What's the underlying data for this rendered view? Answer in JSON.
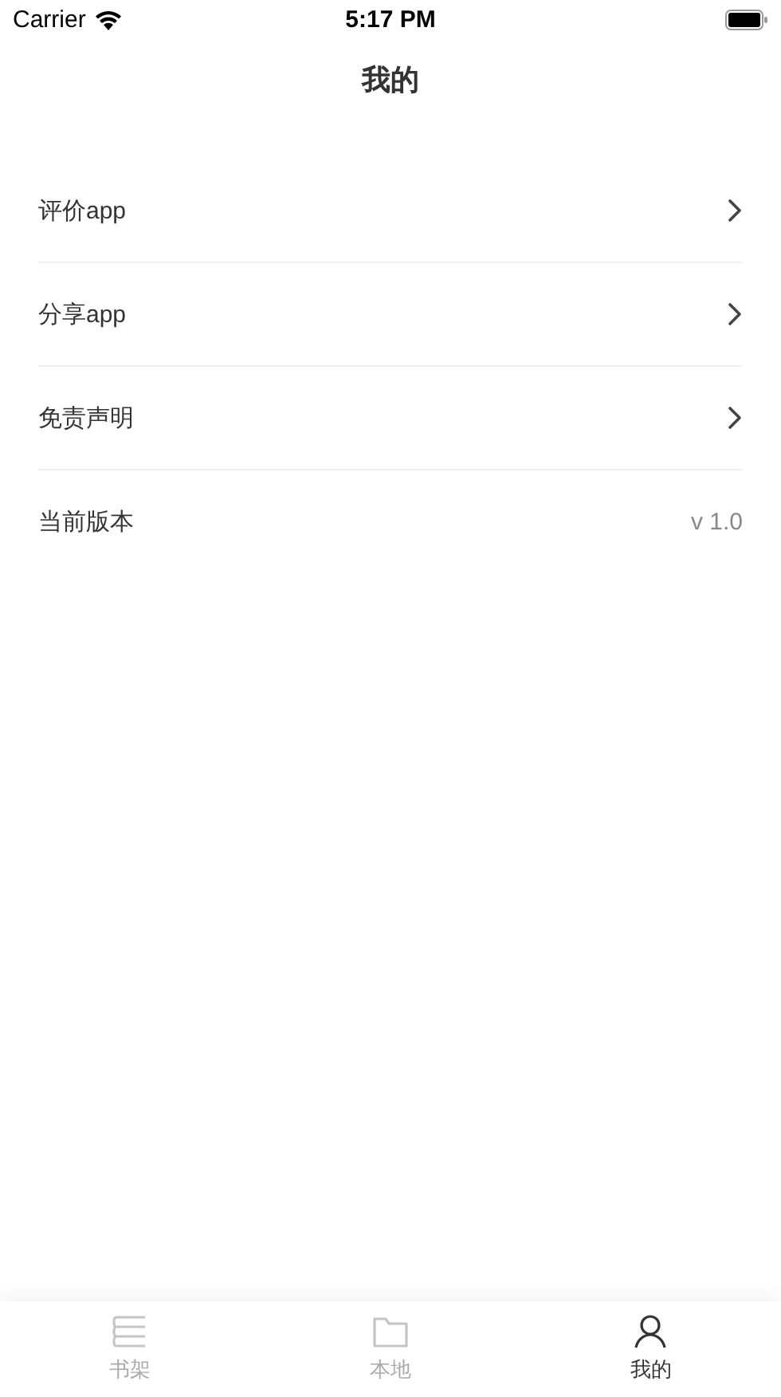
{
  "status_bar": {
    "carrier": "Carrier",
    "time": "5:17 PM"
  },
  "title": "我的",
  "rows": [
    {
      "kind": "link",
      "label": "评价app"
    },
    {
      "kind": "link",
      "label": "分享app"
    },
    {
      "kind": "link",
      "label": "免责声明"
    },
    {
      "kind": "info",
      "label": "当前版本",
      "value": "v 1.0"
    }
  ],
  "tabs": [
    {
      "kind": "books",
      "label": "书架",
      "selected": false
    },
    {
      "kind": "folder",
      "label": "本地",
      "selected": false
    },
    {
      "kind": "person",
      "label": "我的",
      "selected": true
    }
  ]
}
